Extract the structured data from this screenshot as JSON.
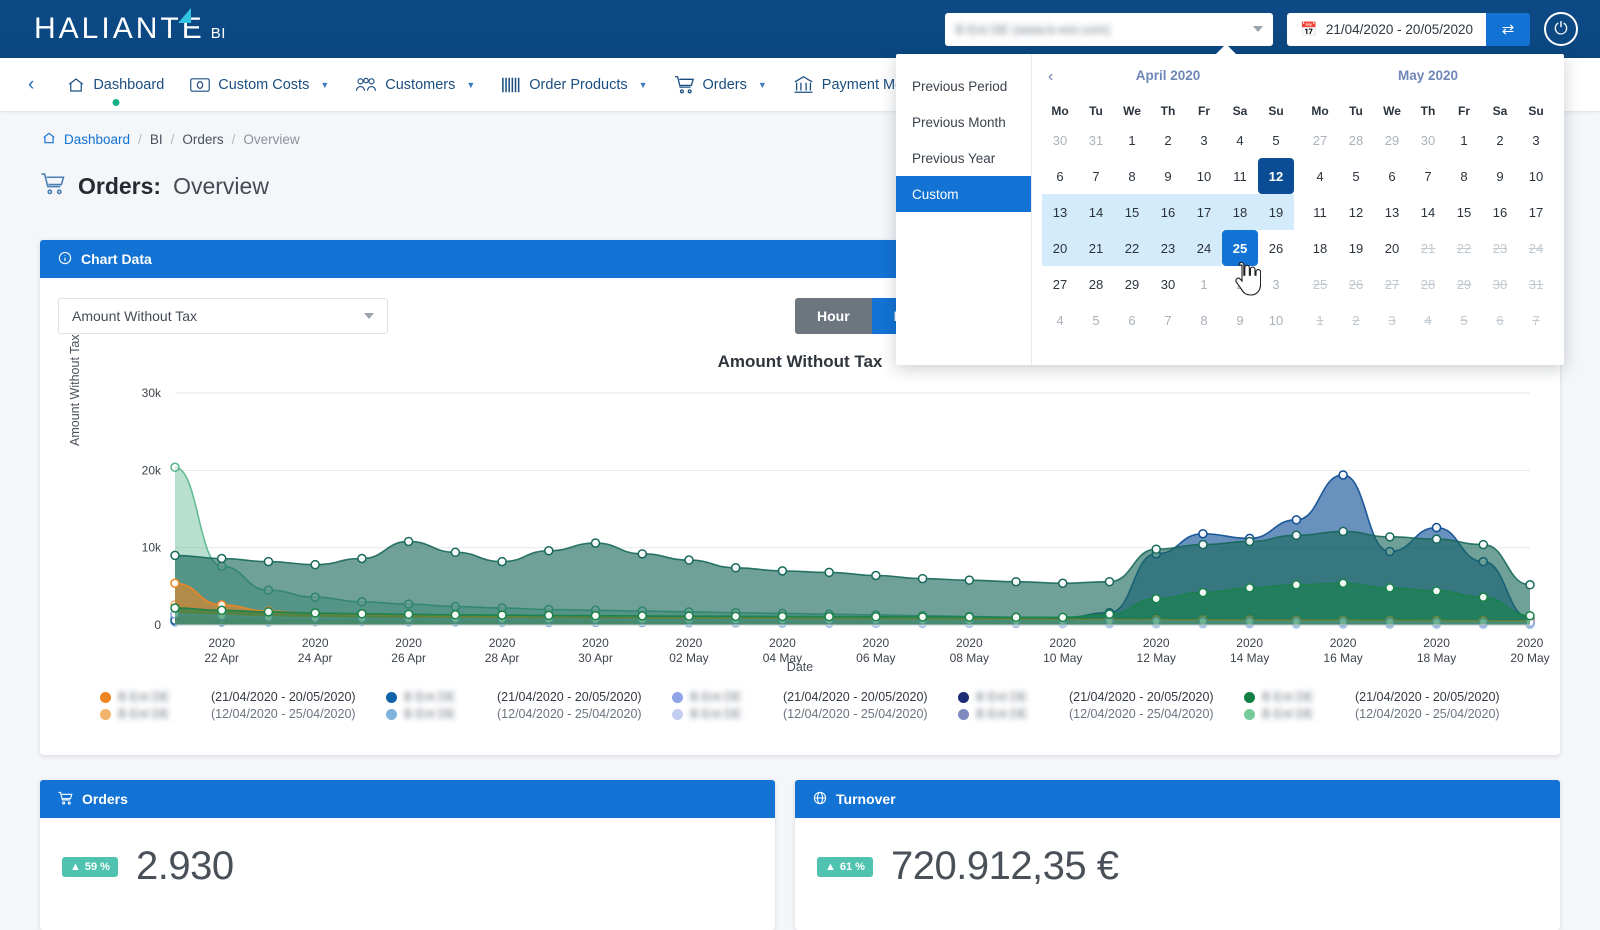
{
  "header": {
    "logo_text": "HALIANT",
    "logo_text_end": "E",
    "logo_suffix": "BI",
    "site_select_value": "B Ent DE (www.b-ent.com)",
    "date_range": "21/04/2020 - 20/05/2020",
    "calendar_icon": "calendar-icon",
    "swap_icon": "⇄",
    "power_icon": "⏻"
  },
  "nav": {
    "back_icon": "‹",
    "items": [
      {
        "label": "Dashboard",
        "icon": "home-icon",
        "has_chevron": false,
        "active": true
      },
      {
        "label": "Custom Costs",
        "icon": "banknote-icon",
        "has_chevron": true,
        "active": false
      },
      {
        "label": "Customers",
        "icon": "users-icon",
        "has_chevron": true,
        "active": false
      },
      {
        "label": "Order Products",
        "icon": "barcode-icon",
        "has_chevron": true,
        "active": false
      },
      {
        "label": "Orders",
        "icon": "cart-icon",
        "has_chevron": true,
        "active": false
      },
      {
        "label": "Payment Method",
        "icon": "bank-icon",
        "has_chevron": false,
        "active": false
      }
    ]
  },
  "breadcrumb": {
    "home_icon": "home-icon",
    "items": [
      "Dashboard",
      "BI",
      "Orders",
      "Overview"
    ],
    "separator": "/"
  },
  "page": {
    "title_icon": "cart-icon",
    "title_bold": "Orders:",
    "title_light": "Overview"
  },
  "chart_card": {
    "header_icon": "info-icon",
    "header_title": "Chart Data",
    "metric_select_value": "Amount Without Tax",
    "granularity": {
      "options": [
        "Hour",
        "Day"
      ],
      "selected": "Day"
    }
  },
  "chart_data": {
    "type": "area",
    "title": "Amount Without Tax",
    "xlabel": "Date",
    "ylabel": "Amount Without Tax",
    "ylim": [
      0,
      30000
    ],
    "yticks": [
      "0",
      "10k",
      "20k",
      "30k"
    ],
    "grid": true,
    "legend_position": "bottom",
    "xtick_labels": [
      "2020\n22 Apr",
      "2020\n24 Apr",
      "2020\n26 Apr",
      "2020\n28 Apr",
      "2020\n30 Apr",
      "2020\n02 May",
      "2020\n04 May",
      "2020\n06 May",
      "2020\n08 May",
      "2020\n10 May",
      "2020\n12 May",
      "2020\n14 May",
      "2020\n16 May",
      "2020\n18 May",
      "2020\n20 May"
    ],
    "x": [
      "21 Apr",
      "22 Apr",
      "23 Apr",
      "24 Apr",
      "25 Apr",
      "26 Apr",
      "27 Apr",
      "28 Apr",
      "29 Apr",
      "30 Apr",
      "01 May",
      "02 May",
      "03 May",
      "04 May",
      "05 May",
      "06 May",
      "07 May",
      "08 May",
      "09 May",
      "10 May",
      "11 May",
      "12 May",
      "13 May",
      "14 May",
      "15 May",
      "16 May",
      "17 May",
      "18 May",
      "19 May",
      "20 May"
    ],
    "series": [
      {
        "name": "series-1-current",
        "color": "#0d4e94",
        "period": "(21/04/2020 - 20/05/2020)",
        "values": [
          600,
          500,
          620,
          760,
          900,
          820,
          700,
          760,
          900,
          1000,
          900,
          820,
          760,
          700,
          640,
          600,
          640,
          700,
          760,
          900,
          1600,
          9200,
          11800,
          11200,
          13600,
          19400,
          9500,
          12600,
          8200,
          900
        ]
      },
      {
        "name": "series-1-previous",
        "color": "#7fb2dd",
        "period": "(12/04/2020 - 25/04/2020)",
        "values": [
          400,
          350,
          380,
          420,
          450,
          400,
          380,
          360,
          340,
          320,
          300,
          290,
          280,
          260,
          250,
          240,
          230,
          220,
          210,
          200,
          190,
          180,
          170,
          160,
          150,
          140,
          130,
          120,
          110,
          100
        ]
      },
      {
        "name": "series-2-current",
        "color": "#17685a",
        "period": "(21/04/2020 - 20/05/2020)",
        "values": [
          9000,
          8600,
          8200,
          7800,
          8600,
          10800,
          9400,
          8200,
          9600,
          10600,
          9200,
          8400,
          7400,
          7000,
          6800,
          6400,
          6000,
          5800,
          5600,
          5400,
          5600,
          9800,
          10400,
          10800,
          11600,
          12100,
          11400,
          11100,
          10400,
          5200
        ]
      },
      {
        "name": "series-2-previous",
        "color": "#58b58c",
        "period": "(12/04/2020 - 25/04/2020)",
        "values": [
          20400,
          7600,
          4500,
          3600,
          3000,
          2700,
          2400,
          2200,
          2000,
          1900,
          1800,
          1700,
          1600,
          1500,
          1400,
          1300,
          1200,
          1100,
          1000,
          950,
          900,
          860,
          820,
          800,
          780,
          760,
          740,
          720,
          700,
          680
        ]
      },
      {
        "name": "series-3-current",
        "color": "#ee8523",
        "period": "(21/04/2020 - 20/05/2020)",
        "values": [
          5400,
          2600,
          1800,
          1500,
          1300,
          1200,
          1100,
          1050,
          1000,
          980,
          950,
          900,
          880,
          860,
          840,
          820,
          800,
          780,
          760,
          740,
          720,
          700,
          680,
          660,
          640,
          620,
          600,
          580,
          560,
          540
        ]
      },
      {
        "name": "series-3-previous",
        "color": "#f2b46b",
        "period": "(12/04/2020 - 25/04/2020)",
        "values": [
          2600,
          1800,
          1400,
          1200,
          1050,
          980,
          920,
          880,
          840,
          800,
          780,
          760,
          740,
          720,
          700,
          680,
          660,
          640,
          620,
          600,
          580,
          560,
          540,
          520,
          500,
          480,
          460,
          440,
          420,
          400
        ]
      },
      {
        "name": "series-4-current",
        "color": "#8fa4e8",
        "period": "(21/04/2020 - 20/05/2020)",
        "values": [
          1400,
          1200,
          1000,
          900,
          850,
          800,
          780,
          760,
          740,
          720,
          700,
          680,
          660,
          640,
          620,
          600,
          580,
          560,
          540,
          520,
          500,
          480,
          460,
          440,
          420,
          400,
          380,
          360,
          340,
          320
        ]
      },
      {
        "name": "series-4-previous",
        "color": "#c2ceef",
        "period": "(12/04/2020 - 25/04/2020)",
        "values": [
          800,
          700,
          650,
          600,
          570,
          540,
          520,
          500,
          480,
          460,
          440,
          420,
          400,
          380,
          360,
          340,
          320,
          300,
          290,
          280,
          270,
          260,
          250,
          240,
          230,
          220,
          210,
          200,
          190,
          180
        ]
      },
      {
        "name": "series-5-current",
        "color": "#18824a",
        "period": "(21/04/2020 - 20/05/2020)",
        "values": [
          2200,
          1900,
          1700,
          1550,
          1450,
          1380,
          1320,
          1280,
          1240,
          1200,
          1180,
          1150,
          1120,
          1100,
          1080,
          1060,
          1040,
          1020,
          1000,
          980,
          1400,
          3400,
          4200,
          4800,
          5200,
          5400,
          4800,
          4400,
          3600,
          1200
        ]
      },
      {
        "name": "series-5-previous",
        "color": "#74cc9a",
        "period": "(12/04/2020 - 25/04/2020)",
        "values": [
          1100,
          980,
          900,
          850,
          800,
          770,
          740,
          720,
          700,
          680,
          660,
          640,
          620,
          600,
          580,
          560,
          540,
          520,
          500,
          480,
          460,
          440,
          420,
          400,
          380,
          360,
          340,
          320,
          300,
          280
        ]
      }
    ],
    "legend": [
      {
        "dot": "#ee8523",
        "name": "B Ent DE",
        "range": "(21/04/2020 - 20/05/2020)"
      },
      {
        "dot": "#f2b46b",
        "name": "B Ent DE",
        "range": "(12/04/2020 - 25/04/2020)"
      },
      {
        "dot": "#1063a8",
        "name": "B Ent DE",
        "range": "(21/04/2020 - 20/05/2020)"
      },
      {
        "dot": "#7fb2dd",
        "name": "B Ent DE",
        "range": "(12/04/2020 - 25/04/2020)"
      },
      {
        "dot": "#8fa4e8",
        "name": "B Ent DE",
        "range": "(21/04/2020 - 20/05/2020)"
      },
      {
        "dot": "#c2ceef",
        "name": "B Ent DE",
        "range": "(12/04/2020 - 25/04/2020)"
      },
      {
        "dot": "#1b2c75",
        "name": "B Ent DE",
        "range": "(21/04/2020 - 20/05/2020)"
      },
      {
        "dot": "#7f8ac0",
        "name": "B Ent DE",
        "range": "(12/04/2020 - 25/04/2020)"
      },
      {
        "dot": "#128045",
        "name": "B Ent DE",
        "range": "(21/04/2020 - 20/05/2020)"
      },
      {
        "dot": "#74cc9a",
        "name": "B Ent DE",
        "range": "(12/04/2020 - 25/04/2020)"
      }
    ]
  },
  "kpis": [
    {
      "header_icon": "cart-icon",
      "header_title": "Orders",
      "badge": "59 %",
      "badge_arrow": "▲",
      "value": "2.930"
    },
    {
      "header_icon": "globe-icon",
      "header_title": "Turnover",
      "badge": "61 %",
      "badge_arrow": "▲",
      "value": "720.912,35 €"
    }
  ],
  "datepicker": {
    "presets": [
      {
        "label": "Previous Period",
        "active": false
      },
      {
        "label": "Previous Month",
        "active": false
      },
      {
        "label": "Previous Year",
        "active": false
      },
      {
        "label": "Custom",
        "active": true
      }
    ],
    "prev_icon": "‹",
    "calendars": [
      {
        "title": "April 2020",
        "dow": [
          "Mo",
          "Tu",
          "We",
          "Th",
          "Fr",
          "Sa",
          "Su"
        ],
        "weeks": [
          [
            {
              "d": "30",
              "s": "muted"
            },
            {
              "d": "31",
              "s": "muted"
            },
            {
              "d": "1",
              "s": ""
            },
            {
              "d": "2",
              "s": ""
            },
            {
              "d": "3",
              "s": ""
            },
            {
              "d": "4",
              "s": ""
            },
            {
              "d": "5",
              "s": ""
            }
          ],
          [
            {
              "d": "6",
              "s": ""
            },
            {
              "d": "7",
              "s": ""
            },
            {
              "d": "8",
              "s": ""
            },
            {
              "d": "9",
              "s": ""
            },
            {
              "d": "10",
              "s": ""
            },
            {
              "d": "11",
              "s": ""
            },
            {
              "d": "12",
              "s": "sel-dark"
            }
          ],
          [
            {
              "d": "13",
              "s": "inrange"
            },
            {
              "d": "14",
              "s": "inrange"
            },
            {
              "d": "15",
              "s": "inrange"
            },
            {
              "d": "16",
              "s": "inrange"
            },
            {
              "d": "17",
              "s": "inrange"
            },
            {
              "d": "18",
              "s": "inrange"
            },
            {
              "d": "19",
              "s": "inrange"
            }
          ],
          [
            {
              "d": "20",
              "s": "inrange"
            },
            {
              "d": "21",
              "s": "inrange"
            },
            {
              "d": "22",
              "s": "inrange"
            },
            {
              "d": "23",
              "s": "inrange"
            },
            {
              "d": "24",
              "s": "inrange"
            },
            {
              "d": "25",
              "s": "sel"
            },
            {
              "d": "26",
              "s": ""
            }
          ],
          [
            {
              "d": "27",
              "s": ""
            },
            {
              "d": "28",
              "s": ""
            },
            {
              "d": "29",
              "s": ""
            },
            {
              "d": "30",
              "s": ""
            },
            {
              "d": "1",
              "s": "muted"
            },
            {
              "d": "2",
              "s": "muted"
            },
            {
              "d": "3",
              "s": "muted"
            }
          ],
          [
            {
              "d": "4",
              "s": "muted"
            },
            {
              "d": "5",
              "s": "muted"
            },
            {
              "d": "6",
              "s": "muted"
            },
            {
              "d": "7",
              "s": "muted"
            },
            {
              "d": "8",
              "s": "muted"
            },
            {
              "d": "9",
              "s": "muted"
            },
            {
              "d": "10",
              "s": "muted"
            }
          ]
        ]
      },
      {
        "title": "May 2020",
        "dow": [
          "Mo",
          "Tu",
          "We",
          "Th",
          "Fr",
          "Sa",
          "Su"
        ],
        "weeks": [
          [
            {
              "d": "27",
              "s": "muted"
            },
            {
              "d": "28",
              "s": "muted"
            },
            {
              "d": "29",
              "s": "muted"
            },
            {
              "d": "30",
              "s": "muted"
            },
            {
              "d": "1",
              "s": ""
            },
            {
              "d": "2",
              "s": ""
            },
            {
              "d": "3",
              "s": ""
            }
          ],
          [
            {
              "d": "4",
              "s": ""
            },
            {
              "d": "5",
              "s": ""
            },
            {
              "d": "6",
              "s": ""
            },
            {
              "d": "7",
              "s": ""
            },
            {
              "d": "8",
              "s": ""
            },
            {
              "d": "9",
              "s": ""
            },
            {
              "d": "10",
              "s": ""
            }
          ],
          [
            {
              "d": "11",
              "s": ""
            },
            {
              "d": "12",
              "s": ""
            },
            {
              "d": "13",
              "s": ""
            },
            {
              "d": "14",
              "s": ""
            },
            {
              "d": "15",
              "s": ""
            },
            {
              "d": "16",
              "s": ""
            },
            {
              "d": "17",
              "s": ""
            }
          ],
          [
            {
              "d": "18",
              "s": ""
            },
            {
              "d": "19",
              "s": ""
            },
            {
              "d": "20",
              "s": ""
            },
            {
              "d": "21",
              "s": "disabled"
            },
            {
              "d": "22",
              "s": "disabled"
            },
            {
              "d": "23",
              "s": "disabled"
            },
            {
              "d": "24",
              "s": "disabled"
            }
          ],
          [
            {
              "d": "25",
              "s": "disabled"
            },
            {
              "d": "26",
              "s": "disabled"
            },
            {
              "d": "27",
              "s": "disabled"
            },
            {
              "d": "28",
              "s": "disabled"
            },
            {
              "d": "29",
              "s": "disabled"
            },
            {
              "d": "30",
              "s": "disabled"
            },
            {
              "d": "31",
              "s": "disabled"
            }
          ],
          [
            {
              "d": "1",
              "s": "disabled"
            },
            {
              "d": "2",
              "s": "disabled"
            },
            {
              "d": "3",
              "s": "disabled"
            },
            {
              "d": "4",
              "s": "disabled"
            },
            {
              "d": "5",
              "s": "disabled"
            },
            {
              "d": "6",
              "s": "disabled"
            },
            {
              "d": "7",
              "s": "disabled"
            }
          ]
        ]
      }
    ]
  },
  "colors": {
    "primary": "#1273d4",
    "header_dark": "#0b4680",
    "teal_badge": "#4fc3b0"
  }
}
